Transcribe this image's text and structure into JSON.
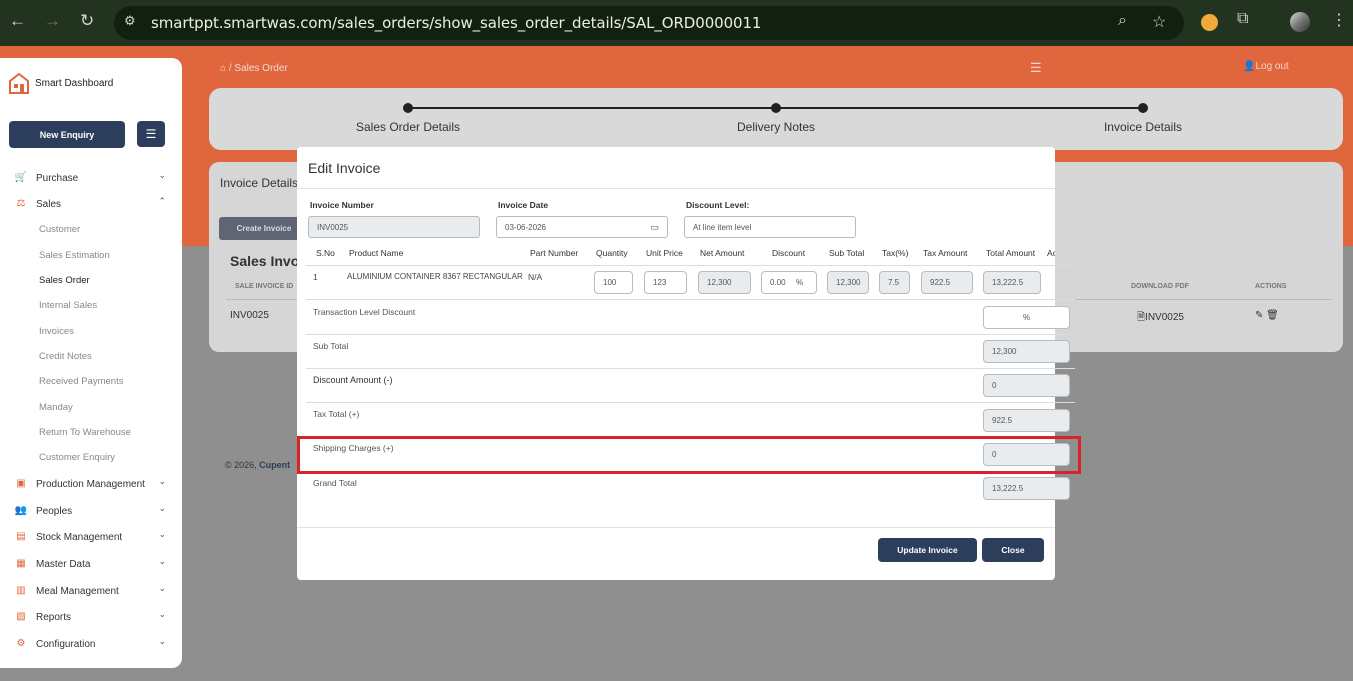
{
  "browser": {
    "url": "smartppt.smartwas.com/sales_orders/show_sales_order_details/SAL_ORD0000011"
  },
  "sidebar": {
    "brand": "Smart Dashboard",
    "new_enquiry": "New Enquiry",
    "menu": [
      {
        "label": "Purchase",
        "icon": "cart-icon"
      },
      {
        "label": "Sales",
        "icon": "sales-icon"
      },
      {
        "label": "Production Management",
        "icon": "production-icon"
      },
      {
        "label": "Peoples",
        "icon": "people-icon"
      },
      {
        "label": "Stock Management",
        "icon": "stock-icon"
      },
      {
        "label": "Master Data",
        "icon": "master-data-icon"
      },
      {
        "label": "Meal Management",
        "icon": "meal-icon"
      },
      {
        "label": "Reports",
        "icon": "reports-icon"
      },
      {
        "label": "Configuration",
        "icon": "config-icon"
      }
    ],
    "sales_sub": [
      "Customer",
      "Sales Estimation",
      "Sales Order",
      "Internal Sales",
      "Invoices",
      "Credit Notes",
      "Received Payments",
      "Manday",
      "Return To Warehouse",
      "Customer Enquiry"
    ]
  },
  "topbar": {
    "breadcrumb": "Sales Order",
    "logout": "Log out"
  },
  "stepper": {
    "steps": [
      "Sales Order Details",
      "Delivery Notes",
      "Invoice Details"
    ]
  },
  "background": {
    "card_title": "Invoice Details",
    "create_invoice": "Create Invoice",
    "section_title": "Sales Invoi",
    "col_invoice_id": "SALE INVOICE ID",
    "col_download": "DOWNLOAD PDF",
    "col_actions": "ACTIONS",
    "row_invoice_id": "INV0025",
    "row_pdf": "INV0025",
    "footer": "© 2026,",
    "footer_brand": "Cupent"
  },
  "modal": {
    "title": "Edit Invoice",
    "invoice_number_label": "Invoice Number",
    "invoice_number": "INV0025",
    "invoice_date_label": "Invoice Date",
    "invoice_date": "03-06-2026",
    "discount_level_label": "Discount Level:",
    "discount_level": "At line item level",
    "headers": [
      "S.No",
      "Product Name",
      "Part Number",
      "Quantity",
      "Unit Price",
      "Net Amount",
      "Discount",
      "Sub Total",
      "Tax(%)",
      "Tax Amount",
      "Total Amount",
      "Action"
    ],
    "row": {
      "sno": "1",
      "product": "ALUMINIUM CONTAINER 8367 RECTANGULAR",
      "part": "N/A",
      "quantity": "100",
      "unit_price": "123",
      "net_amount": "12,300",
      "discount": "0.00",
      "discount_unit": "%",
      "sub_total": "12,300",
      "tax": "7.5",
      "tax_amount": "922.5",
      "total_amount": "13,222.5"
    },
    "summary": {
      "transaction_discount_label": "Transaction Level Discount",
      "transaction_discount_unit": "%",
      "sub_total_label": "Sub Total",
      "sub_total": "12,300",
      "discount_amount_label": "Discount Amount (-)",
      "discount_amount": "0",
      "tax_total_label": "Tax Total (+)",
      "tax_total": "922.5",
      "shipping_label": "Shipping Charges (+)",
      "shipping": "0",
      "grand_total_label": "Grand Total",
      "grand_total": "13,222.5"
    },
    "update_button": "Update Invoice",
    "close_button": "Close"
  },
  "colors": {
    "brand_orange": "#e0663e",
    "navy_button": "#2d3e5c",
    "highlight_red": "#d9232a"
  }
}
